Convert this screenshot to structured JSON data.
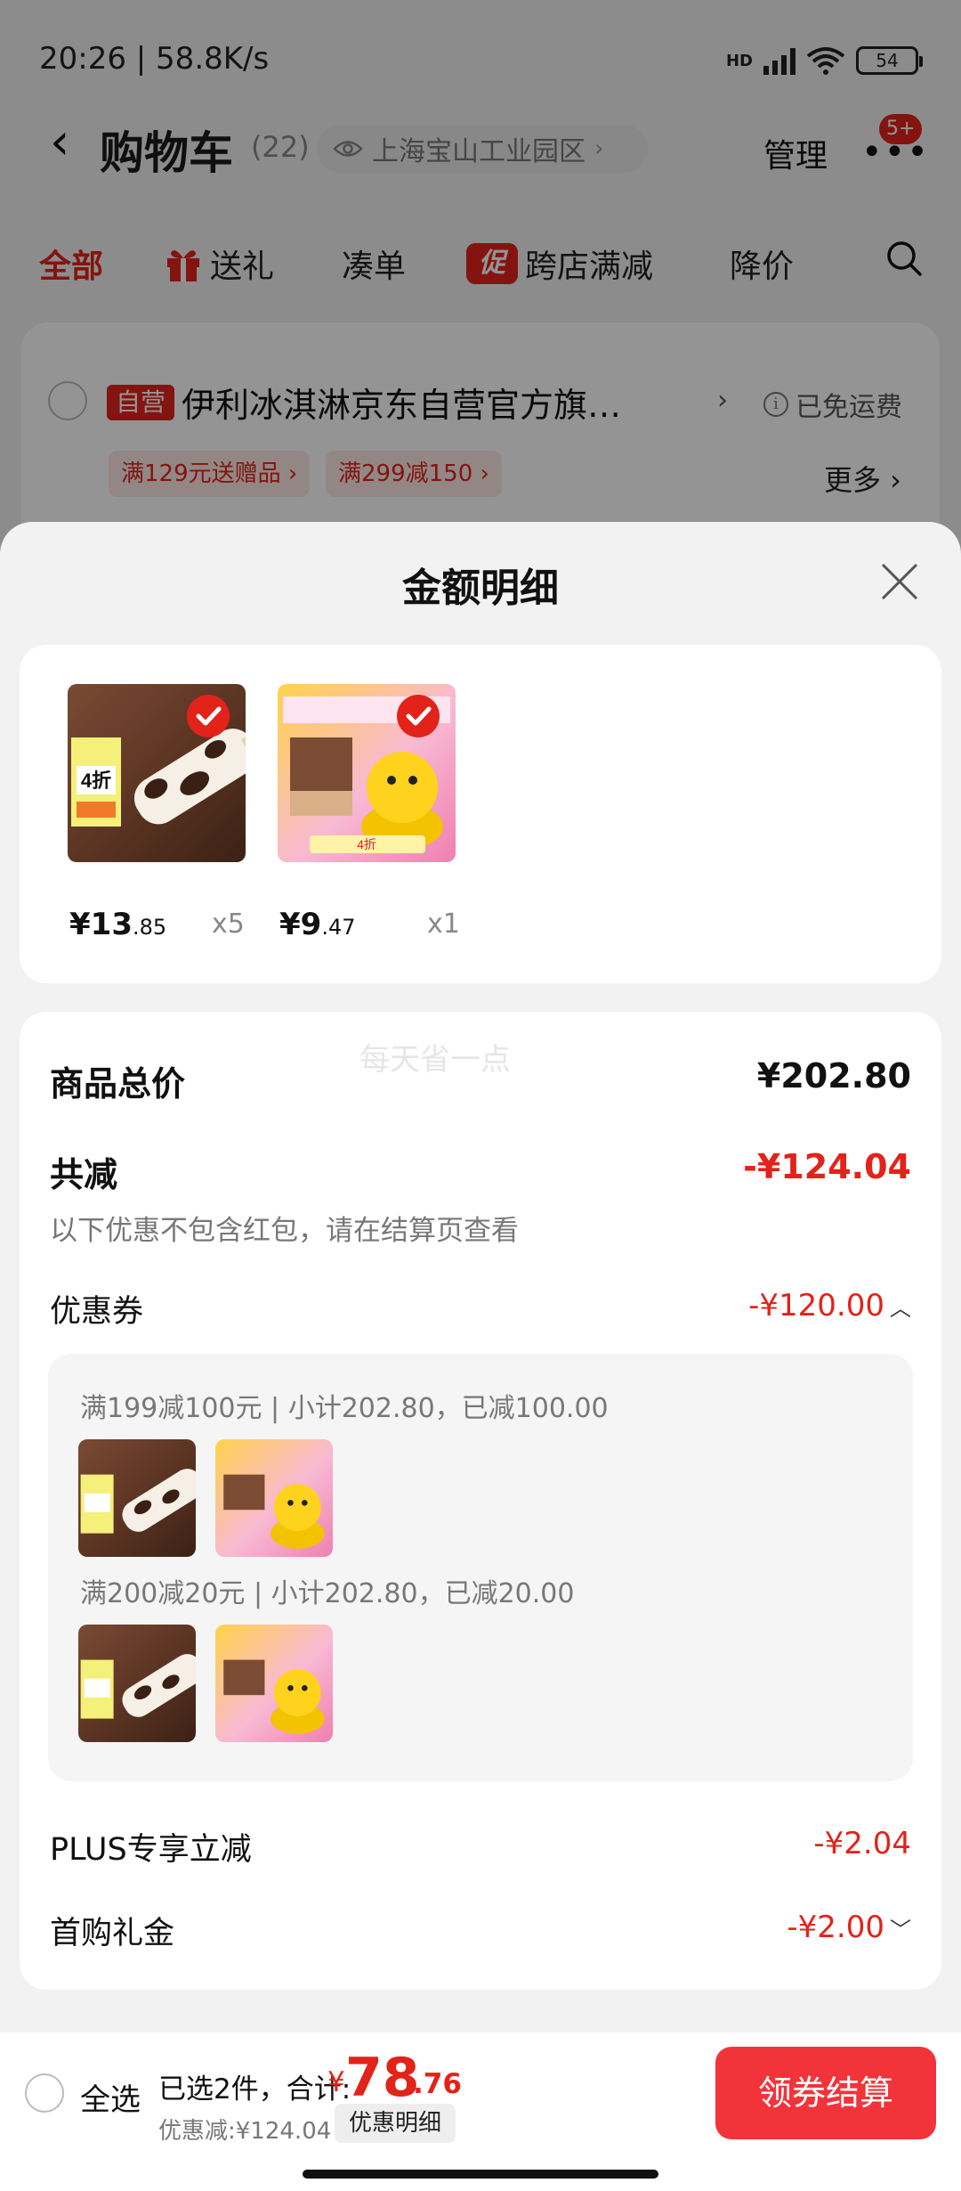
{
  "status_bar": {
    "time": "20:26 | 58.8K/s",
    "net_type": "HD",
    "battery": "54"
  },
  "header": {
    "title": "购物车",
    "count": "(22)",
    "location": "上海宝山工业园区",
    "manage_label": "管理",
    "badge": "5+"
  },
  "tabs": [
    {
      "label": "全部"
    },
    {
      "label": "送礼"
    },
    {
      "label": "凑单"
    },
    {
      "label": "跨店满减",
      "tag": "促"
    },
    {
      "label": "降价"
    }
  ],
  "store": {
    "self_tag": "自营",
    "name": "伊利冰淇淋京东自营官方旗…",
    "shipping": "已免运费",
    "promos": [
      "满129元送赠品 ›",
      "满299减150 ›"
    ],
    "more": "更多 ›"
  },
  "sheet": {
    "title": "金额明细",
    "items": [
      {
        "price_int": "¥13",
        "price_dec": ".85",
        "qty": "x5"
      },
      {
        "price_int": "¥9",
        "price_dec": ".47",
        "qty": "x1"
      }
    ],
    "watermark": "每天省一点",
    "goods_total_label": "商品总价",
    "goods_total_value": "¥202.80",
    "total_discount_label": "共减",
    "total_discount_value": "-¥124.04",
    "discount_note": "以下优惠不包含红包，请在结算页查看",
    "coupon_label": "优惠券",
    "coupon_value": "-¥120.00",
    "coupon_lines": [
      "满199减100元 | 小计202.80，已减100.00",
      "满200减20元 | 小计202.80，已减20.00"
    ],
    "plus_label": "PLUS专享立减",
    "plus_value": "-¥2.04",
    "first_buy_label": "首购礼金",
    "first_buy_value": "-¥2.00"
  },
  "checkout": {
    "select_all": "全选",
    "selected_summary": "已选2件，合计:",
    "currency": "¥",
    "amount_int": "78",
    "amount_dec": ".76",
    "discount_summary": "优惠减:¥124.04",
    "detail_chip": "优惠明细",
    "button": "领券结算"
  },
  "colors": {
    "accent": "#e2231a",
    "checkout_button": "#f2333a"
  }
}
